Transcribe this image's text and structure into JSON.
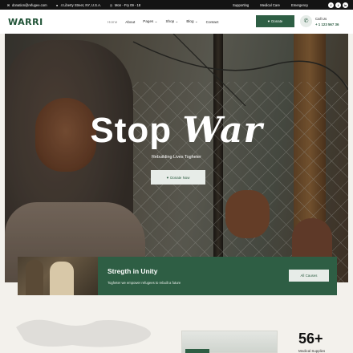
{
  "topbar": {
    "email": "donation@refugee.com",
    "address": "4 Liberty Street, NY, U.S.A.",
    "hours": "Mon - Fry 09 - 18",
    "links": [
      "Supporting",
      "Medical Care",
      "Emergency"
    ],
    "socials": [
      "f",
      "t",
      "in"
    ]
  },
  "nav": {
    "logo": "WARRI",
    "menu": [
      "Home",
      "About",
      "Pages",
      "Shop",
      "Blog",
      "Contact"
    ],
    "donate_label": "Donate",
    "call_label": "Call Us",
    "phone": "+ 1 123 567 36"
  },
  "hero": {
    "title_part1": "Stop",
    "title_part2": "War",
    "subtitle": "Rebuilding Lives Togheter",
    "button_label": "Donate Now"
  },
  "card": {
    "title": "Stregth in Unity",
    "subtitle": "Togheter we empower refugees to rebuilt a future",
    "button_label": "All Causes"
  },
  "stats": {
    "number": "56+",
    "label": "Medical Supplies"
  },
  "colors": {
    "brand_green": "#2e5e44",
    "topbar_bg": "#141414",
    "page_bg": "#f3f1ec"
  },
  "icons": {
    "email": "email-icon",
    "address": "location-icon",
    "hours": "clock-icon",
    "donate": "donate-icon",
    "phone": "phone-icon"
  }
}
